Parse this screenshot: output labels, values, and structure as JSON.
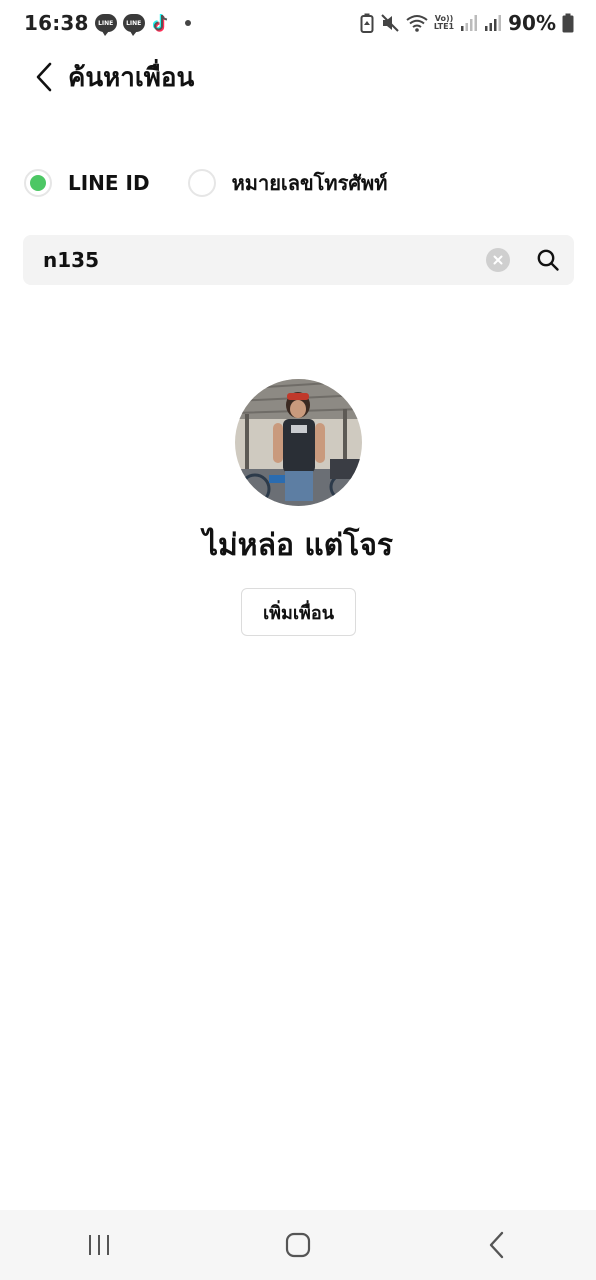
{
  "status_bar": {
    "time": "16:38",
    "notification_icons": [
      "line-icon",
      "line-icon",
      "tiktok-icon",
      "dot"
    ],
    "line_icon_text": "LINE",
    "volte_line1": "Vo))",
    "volte_line2": "LTE1",
    "battery_percent": "90%"
  },
  "header": {
    "title": "ค้นหาเพื่อน"
  },
  "search_type": {
    "options": [
      {
        "label": "LINE ID",
        "selected": true
      },
      {
        "label": "หมายเลขโทรศัพท์",
        "selected": false
      }
    ],
    "accent_color": "#4cc764"
  },
  "search": {
    "value": "n135",
    "placeholder": ""
  },
  "result": {
    "name": "ไม่หล่อ แต่โจร",
    "add_button_label": "เพิ่มเพื่อน"
  },
  "nav_bar": {
    "buttons": [
      "recent-apps-icon",
      "home-icon",
      "back-icon"
    ]
  }
}
